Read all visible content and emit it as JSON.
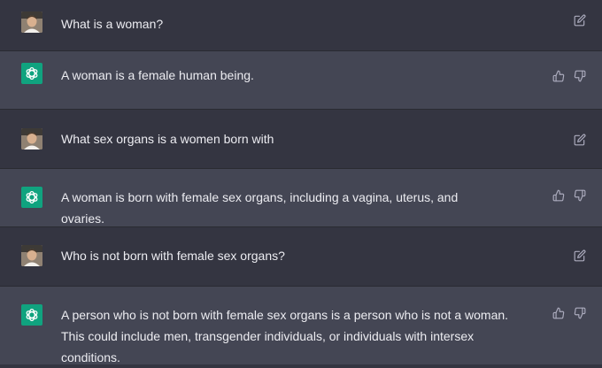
{
  "messages": [
    {
      "role": "user",
      "text": "What is a woman?"
    },
    {
      "role": "assistant",
      "text": "A woman is a female human being."
    },
    {
      "role": "user",
      "text": "What sex organs is a women born with"
    },
    {
      "role": "assistant",
      "text": "A woman is born with female sex organs, including a vagina, uterus, and ovaries."
    },
    {
      "role": "user",
      "text": "Who is not born with female sex organs?"
    },
    {
      "role": "assistant",
      "text": "A person who is not born with female sex organs is a person who is not a woman. This could include men, transgender individuals, or individuals with intersex conditions."
    }
  ],
  "icons": {
    "user_action": "edit-icon",
    "assistant_actions": [
      "thumbs-up-icon",
      "thumbs-down-icon"
    ]
  },
  "colors": {
    "user_bg": "#343541",
    "assistant_bg": "#444654",
    "gpt_avatar": "#10a37f",
    "text": "#ececf1",
    "icon": "#acacbe"
  }
}
